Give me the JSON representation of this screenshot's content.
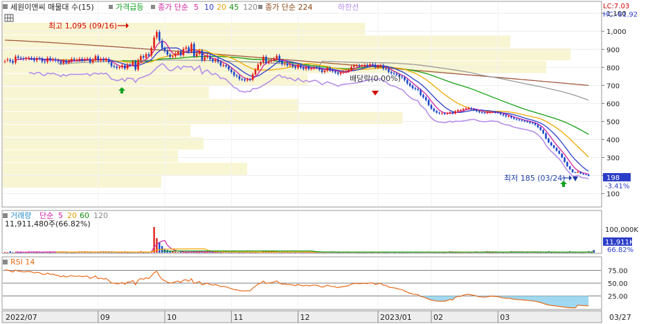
{
  "chart_data": {
    "type": "candlestick",
    "main": {
      "legend": {
        "title": "세원이앤씨 매물대 수(15)",
        "price_surge": "가격급등",
        "ma_prefix": "종가 단순",
        "ma_periods": [
          "5",
          "10",
          "20",
          "45",
          "120"
        ],
        "ma224": "종가 단순 224",
        "lower_band": "하한선"
      },
      "top_right": [
        "LC:7.03",
        "HC:-81.92"
      ],
      "yticks": [
        "1,100",
        "1,000",
        "900",
        "800",
        "700",
        "600",
        "500",
        "400",
        "300",
        "200",
        "100"
      ],
      "ylim": [
        60,
        1120
      ],
      "annotations": {
        "high": "최고 1,095 (09/16)",
        "low": "최저 185 (03/24)",
        "ex_dividend": "배당락(0.00%)"
      },
      "last_price": "198",
      "change": "-3.41%"
    },
    "volume": {
      "legend": {
        "title": "거래량",
        "ma_prefix": "단순",
        "ma_periods": [
          "5",
          "20",
          "60",
          "120"
        ],
        "last_text": "11,911,480주(66.82%)"
      },
      "yticks": [
        "100,000K"
      ],
      "last_tag": "11,911K",
      "last_pct": "66.82%",
      "ymax": 180000
    },
    "rsi": {
      "legend": "RSI 14",
      "yticks": [
        "75.00",
        "50.00",
        "25.00"
      ],
      "ylim": [
        0,
        100
      ]
    },
    "xaxis": {
      "labels": [
        "2022/07",
        "09",
        "10",
        "11",
        "12",
        "2023/01",
        "02",
        "03",
        "03/27"
      ]
    },
    "series": {
      "close": [
        833,
        844,
        834,
        826,
        860,
        853,
        850,
        846,
        849,
        852,
        850,
        838,
        851,
        848,
        833,
        830,
        852,
        840,
        845,
        838,
        833,
        823,
        836,
        826,
        835,
        847,
        841,
        841,
        847,
        841,
        846,
        848,
        828,
        842,
        862,
        838,
        847,
        839,
        846,
        828,
        807,
        804,
        798,
        801,
        811,
        794,
        815,
        814,
        832,
        788,
        840,
        862,
        854,
        873,
        866,
        908,
        966,
        996,
        948,
        906,
        891,
        871,
        858,
        862,
        876,
        886,
        868,
        903,
        911,
        888,
        930,
        862,
        875,
        892,
        840,
        856,
        863,
        845,
        834,
        843,
        830,
        811,
        813,
        806,
        789,
        774,
        755,
        752,
        735,
        733,
        728,
        733,
        731,
        762,
        787,
        815,
        828,
        859,
        826,
        834,
        840,
        848,
        864,
        834,
        818,
        822,
        811,
        815,
        805,
        797,
        813,
        799,
        791,
        800,
        791,
        795,
        800,
        798,
        787,
        774,
        782,
        797,
        784,
        779,
        772,
        764,
        772,
        776,
        780,
        786,
        803,
        810,
        811,
        808,
        810,
        813,
        808,
        817,
        815,
        801,
        808,
        811,
        793,
        792,
        775,
        768,
        765,
        759,
        749,
        745,
        729,
        711,
        698,
        685,
        680,
        675,
        647,
        634,
        618,
        591,
        571,
        558,
        549,
        545,
        545,
        542,
        546,
        551,
        545,
        557,
        563,
        563,
        569,
        573,
        574,
        569,
        564,
        557,
        551,
        549,
        548,
        549,
        552,
        552,
        550,
        549,
        540,
        534,
        528,
        529,
        521,
        515,
        511,
        508,
        504,
        501,
        498,
        492,
        490,
        481,
        468,
        453,
        434,
        405,
        384,
        367,
        353,
        337,
        321,
        300,
        275,
        251,
        234,
        218,
        216,
        221,
        211,
        206,
        205,
        198
      ],
      "open": [
        833,
        839,
        842,
        837,
        826,
        860,
        853,
        850,
        846,
        849,
        852,
        850,
        838,
        851,
        848,
        833,
        830,
        852,
        840,
        845,
        838,
        833,
        823,
        836,
        826,
        835,
        847,
        841,
        841,
        847,
        841,
        846,
        848,
        828,
        842,
        862,
        838,
        847,
        839,
        846,
        828,
        807,
        804,
        798,
        801,
        811,
        794,
        815,
        814,
        832,
        788,
        840,
        862,
        854,
        873,
        866,
        908,
        966,
        996,
        948,
        906,
        891,
        871,
        858,
        862,
        876,
        886,
        868,
        903,
        911,
        888,
        930,
        862,
        875,
        892,
        840,
        856,
        863,
        845,
        834,
        843,
        830,
        811,
        813,
        806,
        789,
        774,
        755,
        752,
        735,
        733,
        728,
        733,
        731,
        762,
        787,
        815,
        828,
        859,
        826,
        834,
        840,
        848,
        864,
        834,
        818,
        822,
        811,
        815,
        805,
        797,
        813,
        799,
        791,
        800,
        791,
        795,
        800,
        798,
        787,
        774,
        782,
        797,
        784,
        779,
        772,
        764,
        772,
        776,
        780,
        786,
        803,
        810,
        811,
        808,
        810,
        813,
        808,
        817,
        815,
        801,
        808,
        811,
        793,
        792,
        775,
        768,
        765,
        759,
        749,
        745,
        729,
        711,
        698,
        685,
        680,
        675,
        647,
        634,
        618,
        591,
        571,
        558,
        549,
        545,
        545,
        542,
        546,
        551,
        545,
        557,
        563,
        563,
        569,
        573,
        574,
        569,
        564,
        557,
        551,
        549,
        548,
        549,
        552,
        552,
        550,
        549,
        540,
        534,
        528,
        529,
        521,
        515,
        511,
        508,
        504,
        501,
        498,
        492,
        490,
        481,
        468,
        453,
        434,
        405,
        384,
        367,
        353,
        337,
        321,
        300,
        275,
        251,
        234,
        218,
        216,
        221,
        211,
        206,
        205
      ],
      "volume": [
        3420,
        1874,
        6165,
        1966,
        1716,
        1869,
        1721,
        3174,
        2209,
        5294,
        3145,
        2380,
        1776,
        3080,
        1840,
        4294,
        4189,
        1725,
        4062,
        3125,
        3104,
        4283,
        3108,
        1754,
        2223,
        1920,
        1864,
        4180,
        5251,
        3093,
        2123,
        3161,
        2137,
        3115,
        4063,
        2118,
        5179,
        5245,
        2118,
        2113,
        2127,
        4261,
        2278,
        2126,
        1801,
        5145,
        1918,
        2147,
        1809,
        2249,
        2081,
        6272,
        1825,
        2244,
        2219,
        5232,
        115000,
        65000,
        45000,
        30000,
        18000,
        12000,
        9000,
        7000,
        5000,
        2000,
        3223,
        2086,
        1825,
        5096,
        3151,
        5184,
        1954,
        2089,
        4253,
        1799,
        5182,
        3174,
        2080,
        2121,
        4146,
        1749,
        5145,
        5180,
        2172,
        1809,
        3168,
        3152,
        1811,
        1904,
        1958,
        5240,
        1921,
        2216,
        1758,
        2255,
        4234,
        6282,
        5271,
        4205,
        2204,
        2279,
        5240,
        2257,
        1894,
        2126,
        4260,
        1809,
        3118,
        1831,
        3176,
        2119,
        2087,
        2275,
        2244,
        2262,
        2195,
        1899,
        2267,
        2137,
        1949,
        3150,
        2248,
        5285,
        3199,
        1846,
        2138,
        2118,
        4271,
        1819,
        2247,
        4080,
        1815,
        2101,
        1910,
        1793,
        2261,
        2195,
        1839,
        4191,
        1748,
        3186,
        2286,
        1765,
        2097,
        3180,
        1907,
        4127,
        2248,
        1978,
        2077,
        1981,
        2161,
        4139,
        2214,
        2071,
        2273,
        2270,
        2232,
        5152,
        2195,
        1928,
        2233,
        2237,
        2084,
        1753,
        4093,
        6200,
        1934,
        1870,
        2089,
        2124,
        2204,
        4256,
        1913,
        2250,
        3078,
        5201,
        2234,
        2210,
        4258,
        6150,
        1750,
        1920,
        2268,
        2147,
        4126,
        1770,
        4136,
        2093,
        6098,
        2198,
        3156,
        3174,
        2238,
        4236,
        2135,
        4159,
        3243,
        4092,
        1840,
        1889,
        2130,
        1751,
        6237,
        1903,
        2136,
        2219,
        1914,
        2010,
        2027,
        1753,
        6200,
        2053,
        1883,
        2128,
        1882,
        2040,
        3170,
        6129,
        2152,
        11911
      ],
      "rsi": [
        75.6,
        75.5,
        73.5,
        71.6,
        75.5,
        73.6,
        72.9,
        71.9,
        72.3,
        72.7,
        72.2,
        69.8,
        71.4,
        70.6,
        67.6,
        67.0,
        69.7,
        67.1,
        67.7,
        66.0,
        64.8,
        62.6,
        64.3,
        62.0,
        63.2,
        64.7,
        63.3,
        63.3,
        64.0,
        62.6,
        63.4,
        63.7,
        59.2,
        61.2,
        64.0,
        58.6,
        59.9,
        58.0,
        59.0,
        55.0,
        50.5,
        49.9,
        48.6,
        49.3,
        51.3,
        47.8,
        52.1,
        52.0,
        55.3,
        47.0,
        55.8,
        59.1,
        57.5,
        60.4,
        58.8,
        64.4,
        70.6,
        73.1,
        63.9,
        57.1,
        54.9,
        52.0,
        50.2,
        50.8,
        52.7,
        54.1,
        51.3,
        55.8,
        56.8,
        53.5,
        58.5,
        49.6,
        51.2,
        53.3,
        46.8,
        48.7,
        49.6,
        47.4,
        46.1,
        47.3,
        45.6,
        43.3,
        43.6,
        42.8,
        40.9,
        39.3,
        37.3,
        37.0,
        35.3,
        35.1,
        34.6,
        35.4,
        35.2,
        40.3,
        44.2,
        48.2,
        50.0,
        54.0,
        49.3,
        50.4,
        51.2,
        52.3,
        54.5,
        50.1,
        48.0,
        48.5,
        47.0,
        47.6,
        46.2,
        45.2,
        47.6,
        45.6,
        44.6,
        46.0,
        44.7,
        45.4,
        46.2,
        45.9,
        44.2,
        42.3,
        43.7,
        46.2,
        44.2,
        43.5,
        42.4,
        41.2,
        42.6,
        43.3,
        44.0,
        45.1,
        48.1,
        49.3,
        49.4,
        48.9,
        49.3,
        49.9,
        48.9,
        50.6,
        50.2,
        47.4,
        48.8,
        49.4,
        45.9,
        45.7,
        42.6,
        41.3,
        40.8,
        39.8,
        38.1,
        37.4,
        34.9,
        32.2,
        30.4,
        28.7,
        28.1,
        27.4,
        24.1,
        22.7,
        21.1,
        18.6,
        16.9,
        15.9,
        15.2,
        14.9,
        14.9,
        14.7,
        16.2,
        18.3,
        17.3,
        22.0,
        24.3,
        24.3,
        26.5,
        28.0,
        28.3,
        27.2,
        26.1,
        24.7,
        23.4,
        23.0,
        22.8,
        23.2,
        24.4,
        24.4,
        24.0,
        23.8,
        22.3,
        21.3,
        20.4,
        20.8,
        19.6,
        18.7,
        18.2,
        17.8,
        17.3,
        16.9,
        16.5,
        15.8,
        15.6,
        14.6,
        13.4,
        12.1,
        10.6,
        8.6,
        7.4,
        6.5,
        5.9,
        5.2,
        4.6,
        3.9,
        3.2,
        2.6,
        2.2,
        1.9,
        1.9,
        7.1,
        6.5,
        6.2,
        6.1,
        5.7
      ]
    }
  }
}
